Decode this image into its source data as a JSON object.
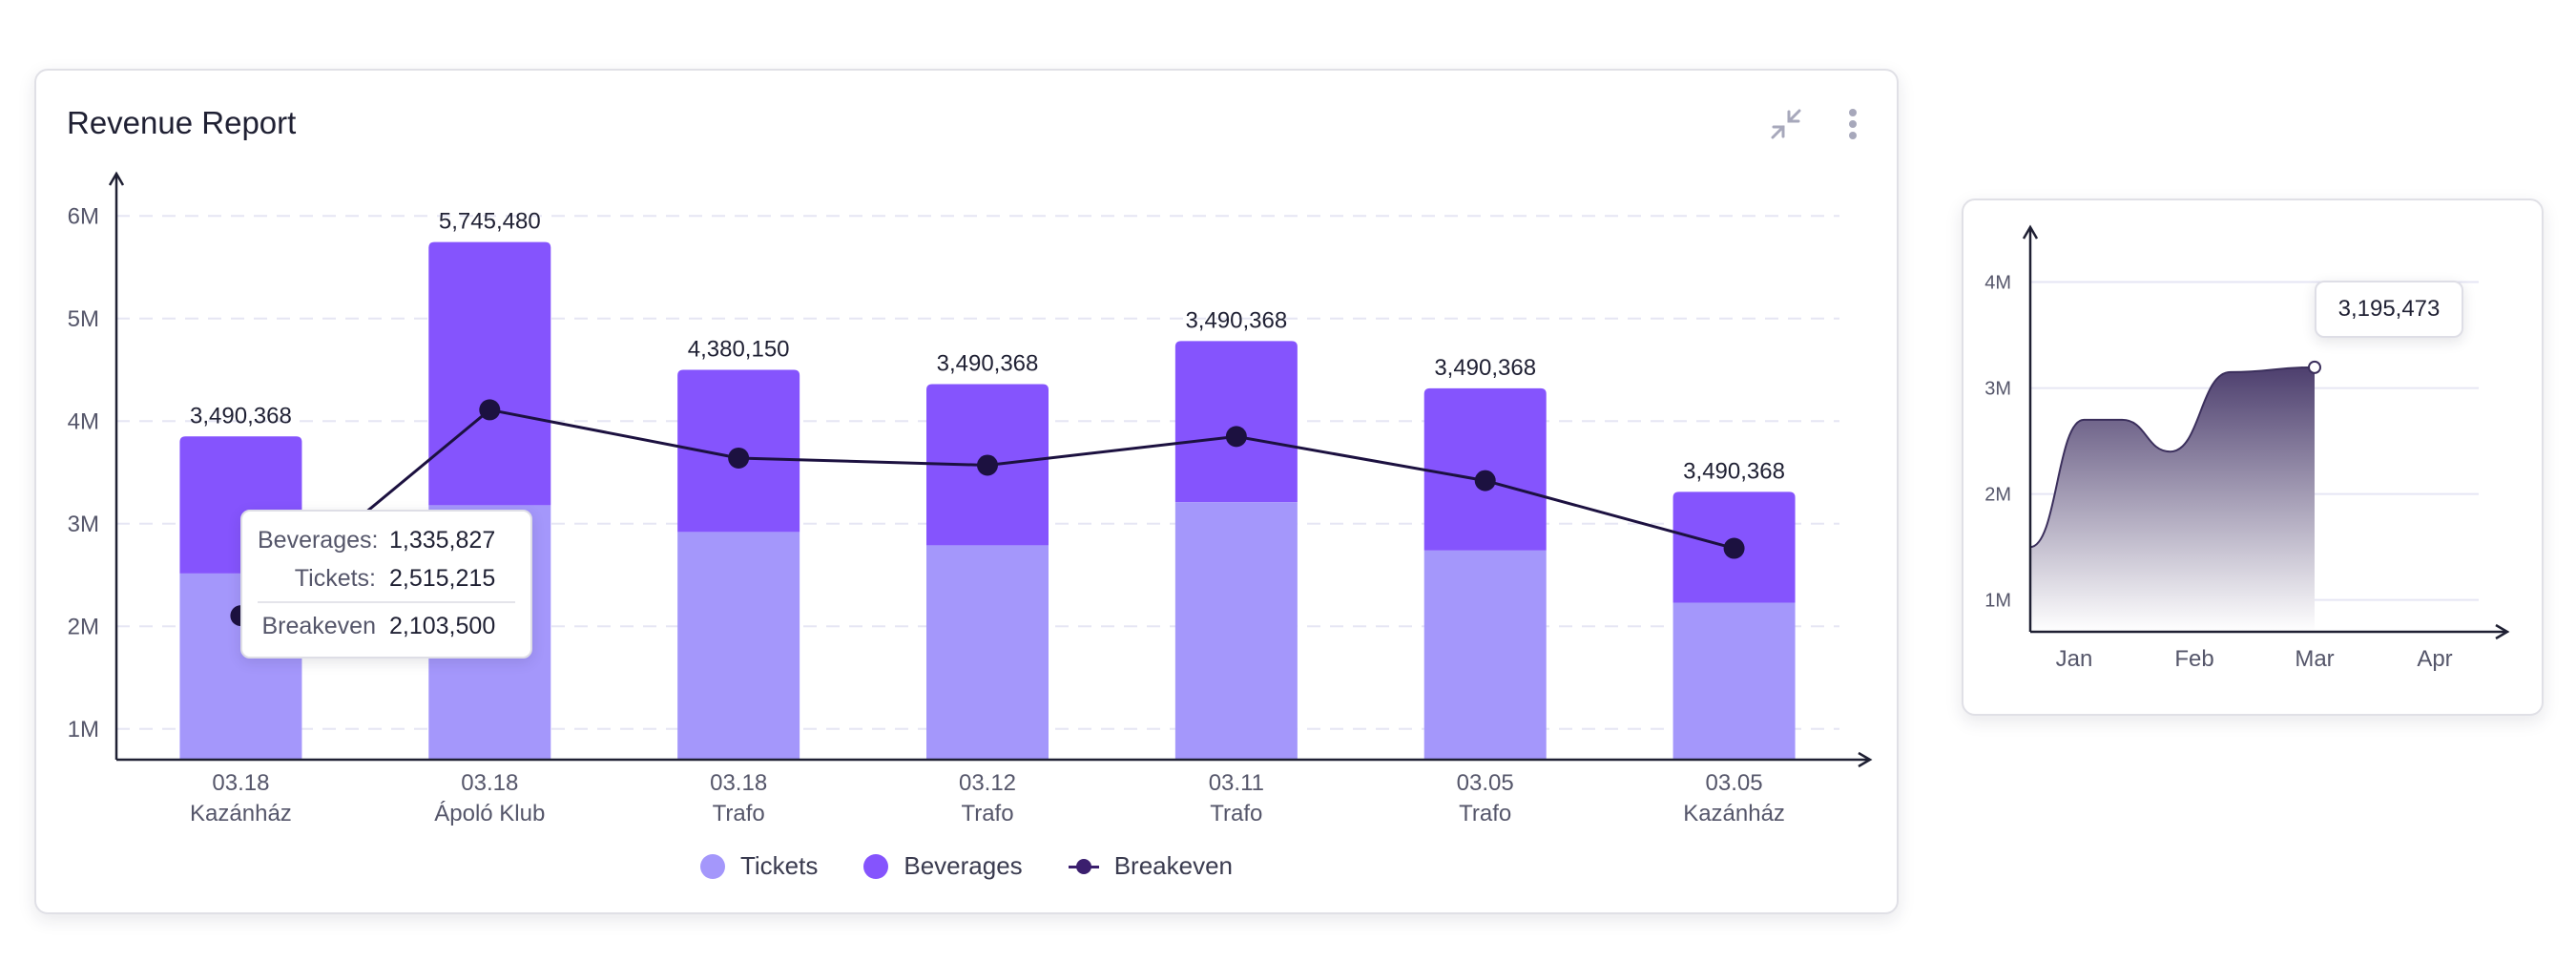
{
  "main_card": {
    "title": "Revenue Report",
    "expand_icon": "collapse-arrows-icon",
    "menu_icon": "more-vertical-icon"
  },
  "tooltip": {
    "rows": [
      {
        "label": "Beverages:",
        "value": "1,335,827"
      },
      {
        "label": "Tickets:",
        "value": "2,515,215"
      },
      {
        "label": "Breakeven",
        "value": "2,103,500"
      }
    ]
  },
  "mini_tooltip": {
    "value": "3,195,473"
  },
  "colors": {
    "tickets": "#a497fb",
    "beverages": "#8554fd",
    "breakeven": "#1c1140",
    "grid": "#e6e6f4",
    "axis": "#1f2033",
    "area_top": "#4d3f6e",
    "area_bottom": "#ffffff"
  },
  "chart_data": [
    {
      "type": "bar",
      "stacked": true,
      "title": "Revenue Report",
      "categories": [
        [
          "03.18",
          "Kazánház"
        ],
        [
          "03.18",
          "Ápoló Klub"
        ],
        [
          "03.18",
          "Trafo"
        ],
        [
          "03.12",
          "Trafo"
        ],
        [
          "03.11",
          "Trafo"
        ],
        [
          "03.05",
          "Trafo"
        ],
        [
          "03.05",
          "Kazánház"
        ]
      ],
      "series": [
        {
          "name": "Tickets",
          "type": "bar",
          "values": [
            2515215,
            3180000,
            2920000,
            2790000,
            3210000,
            2740000,
            2230000
          ]
        },
        {
          "name": "Beverages",
          "type": "bar",
          "values": [
            1335827,
            2565480,
            1580000,
            1570000,
            1570000,
            1580000,
            1080000
          ]
        },
        {
          "name": "Breakeven",
          "type": "line",
          "values": [
            2103500,
            4110000,
            3640000,
            3570000,
            3850000,
            3420000,
            2760000
          ]
        }
      ],
      "totals_labels": [
        "3,490,368",
        "5,745,480",
        "4,380,150",
        "3,490,368",
        "3,490,368",
        "3,490,368",
        "3,490,368"
      ],
      "y_ticks": [
        "1M",
        "2M",
        "3M",
        "4M",
        "5M",
        "6M"
      ],
      "y_tick_values": [
        1000000,
        2000000,
        3000000,
        4000000,
        5000000,
        6000000
      ],
      "ylim": [
        700000,
        6300000
      ],
      "grid": true,
      "legend_position": "bottom-center"
    },
    {
      "type": "area",
      "x": [
        "Jan",
        "Feb",
        "Mar",
        "Apr"
      ],
      "y_ticks": [
        "1M",
        "2M",
        "3M",
        "4M"
      ],
      "y_tick_values": [
        1000000,
        2000000,
        3000000,
        4000000
      ],
      "ylim": [
        700000,
        4500000
      ],
      "points": [
        {
          "x": 0.0,
          "y": 1500000
        },
        {
          "x": 0.08,
          "y": 2700000
        },
        {
          "x": 0.4,
          "y": 2700000
        },
        {
          "x": 0.8,
          "y": 2400000
        },
        {
          "x": 1.3,
          "y": 3150000
        },
        {
          "x": 2.0,
          "y": 3195473
        }
      ],
      "highlight_value": 3195473,
      "grid": true
    }
  ]
}
